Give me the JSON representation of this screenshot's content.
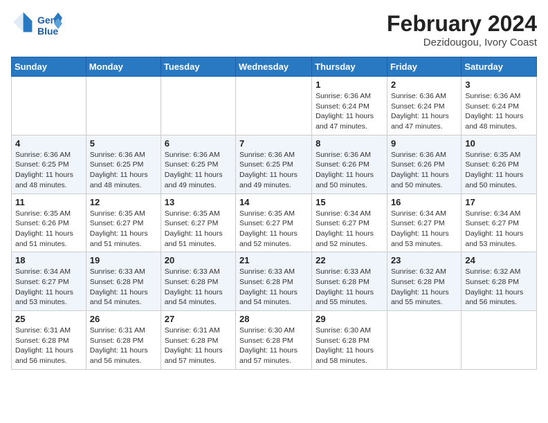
{
  "header": {
    "logo_line1": "General",
    "logo_line2": "Blue",
    "month_title": "February 2024",
    "location": "Dezidougou, Ivory Coast"
  },
  "calendar": {
    "days_of_week": [
      "Sunday",
      "Monday",
      "Tuesday",
      "Wednesday",
      "Thursday",
      "Friday",
      "Saturday"
    ],
    "weeks": [
      [
        {
          "day": "",
          "info": ""
        },
        {
          "day": "",
          "info": ""
        },
        {
          "day": "",
          "info": ""
        },
        {
          "day": "",
          "info": ""
        },
        {
          "day": "1",
          "info": "Sunrise: 6:36 AM\nSunset: 6:24 PM\nDaylight: 11 hours and 47 minutes."
        },
        {
          "day": "2",
          "info": "Sunrise: 6:36 AM\nSunset: 6:24 PM\nDaylight: 11 hours and 47 minutes."
        },
        {
          "day": "3",
          "info": "Sunrise: 6:36 AM\nSunset: 6:24 PM\nDaylight: 11 hours and 48 minutes."
        }
      ],
      [
        {
          "day": "4",
          "info": "Sunrise: 6:36 AM\nSunset: 6:25 PM\nDaylight: 11 hours and 48 minutes."
        },
        {
          "day": "5",
          "info": "Sunrise: 6:36 AM\nSunset: 6:25 PM\nDaylight: 11 hours and 48 minutes."
        },
        {
          "day": "6",
          "info": "Sunrise: 6:36 AM\nSunset: 6:25 PM\nDaylight: 11 hours and 49 minutes."
        },
        {
          "day": "7",
          "info": "Sunrise: 6:36 AM\nSunset: 6:25 PM\nDaylight: 11 hours and 49 minutes."
        },
        {
          "day": "8",
          "info": "Sunrise: 6:36 AM\nSunset: 6:26 PM\nDaylight: 11 hours and 50 minutes."
        },
        {
          "day": "9",
          "info": "Sunrise: 6:36 AM\nSunset: 6:26 PM\nDaylight: 11 hours and 50 minutes."
        },
        {
          "day": "10",
          "info": "Sunrise: 6:35 AM\nSunset: 6:26 PM\nDaylight: 11 hours and 50 minutes."
        }
      ],
      [
        {
          "day": "11",
          "info": "Sunrise: 6:35 AM\nSunset: 6:26 PM\nDaylight: 11 hours and 51 minutes."
        },
        {
          "day": "12",
          "info": "Sunrise: 6:35 AM\nSunset: 6:27 PM\nDaylight: 11 hours and 51 minutes."
        },
        {
          "day": "13",
          "info": "Sunrise: 6:35 AM\nSunset: 6:27 PM\nDaylight: 11 hours and 51 minutes."
        },
        {
          "day": "14",
          "info": "Sunrise: 6:35 AM\nSunset: 6:27 PM\nDaylight: 11 hours and 52 minutes."
        },
        {
          "day": "15",
          "info": "Sunrise: 6:34 AM\nSunset: 6:27 PM\nDaylight: 11 hours and 52 minutes."
        },
        {
          "day": "16",
          "info": "Sunrise: 6:34 AM\nSunset: 6:27 PM\nDaylight: 11 hours and 53 minutes."
        },
        {
          "day": "17",
          "info": "Sunrise: 6:34 AM\nSunset: 6:27 PM\nDaylight: 11 hours and 53 minutes."
        }
      ],
      [
        {
          "day": "18",
          "info": "Sunrise: 6:34 AM\nSunset: 6:27 PM\nDaylight: 11 hours and 53 minutes."
        },
        {
          "day": "19",
          "info": "Sunrise: 6:33 AM\nSunset: 6:28 PM\nDaylight: 11 hours and 54 minutes."
        },
        {
          "day": "20",
          "info": "Sunrise: 6:33 AM\nSunset: 6:28 PM\nDaylight: 11 hours and 54 minutes."
        },
        {
          "day": "21",
          "info": "Sunrise: 6:33 AM\nSunset: 6:28 PM\nDaylight: 11 hours and 54 minutes."
        },
        {
          "day": "22",
          "info": "Sunrise: 6:33 AM\nSunset: 6:28 PM\nDaylight: 11 hours and 55 minutes."
        },
        {
          "day": "23",
          "info": "Sunrise: 6:32 AM\nSunset: 6:28 PM\nDaylight: 11 hours and 55 minutes."
        },
        {
          "day": "24",
          "info": "Sunrise: 6:32 AM\nSunset: 6:28 PM\nDaylight: 11 hours and 56 minutes."
        }
      ],
      [
        {
          "day": "25",
          "info": "Sunrise: 6:31 AM\nSunset: 6:28 PM\nDaylight: 11 hours and 56 minutes."
        },
        {
          "day": "26",
          "info": "Sunrise: 6:31 AM\nSunset: 6:28 PM\nDaylight: 11 hours and 56 minutes."
        },
        {
          "day": "27",
          "info": "Sunrise: 6:31 AM\nSunset: 6:28 PM\nDaylight: 11 hours and 57 minutes."
        },
        {
          "day": "28",
          "info": "Sunrise: 6:30 AM\nSunset: 6:28 PM\nDaylight: 11 hours and 57 minutes."
        },
        {
          "day": "29",
          "info": "Sunrise: 6:30 AM\nSunset: 6:28 PM\nDaylight: 11 hours and 58 minutes."
        },
        {
          "day": "",
          "info": ""
        },
        {
          "day": "",
          "info": ""
        }
      ]
    ]
  }
}
